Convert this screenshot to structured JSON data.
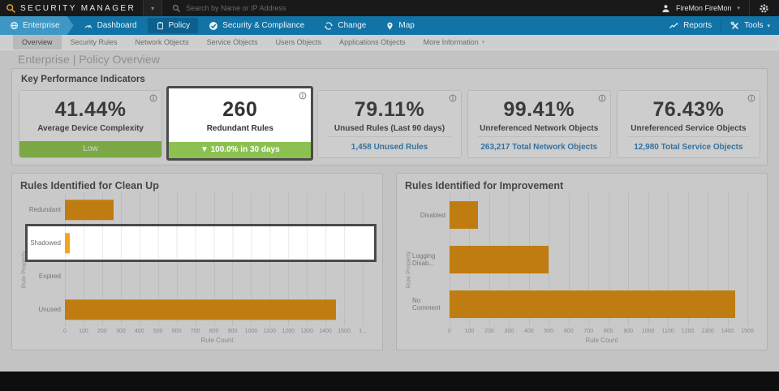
{
  "topbar": {
    "logo": "SECURITY MANAGER",
    "search_placeholder": "Search by Name or IP Address",
    "user": "FireMon FireMon"
  },
  "nav": {
    "items": [
      {
        "label": "Enterprise"
      },
      {
        "label": "Dashboard"
      },
      {
        "label": "Policy"
      },
      {
        "label": "Security & Compliance"
      },
      {
        "label": "Change"
      },
      {
        "label": "Map"
      }
    ],
    "right": [
      {
        "label": "Reports"
      },
      {
        "label": "Tools"
      }
    ]
  },
  "subnav": {
    "items": [
      {
        "label": "Overview",
        "active": true
      },
      {
        "label": "Security Rules"
      },
      {
        "label": "Network Objects"
      },
      {
        "label": "Service Objects"
      },
      {
        "label": "Users Objects"
      },
      {
        "label": "Applications Objects"
      },
      {
        "label": "More Information",
        "caret": true
      }
    ]
  },
  "breadcrumb": "Enterprise | Policy Overview",
  "kpi": {
    "heading": "Key Performance Indicators",
    "cards": [
      {
        "value": "41.44%",
        "label": "Average Device Complexity",
        "footer_type": "badge",
        "footer_text": "Low",
        "highlighted": false
      },
      {
        "value": "260",
        "label": "Redundant Rules",
        "footer_type": "badge",
        "footer_text": "▼ 100.0% in 30 days",
        "highlighted": true
      },
      {
        "value": "79.11%",
        "label": "Unused Rules (Last 90 days)",
        "footer_type": "link",
        "footer_text": "1,458 Unused Rules",
        "highlighted": false
      },
      {
        "value": "99.41%",
        "label": "Unreferenced Network Objects",
        "footer_type": "link",
        "footer_text": "263,217 Total Network Objects",
        "highlighted": false
      },
      {
        "value": "76.43%",
        "label": "Unreferenced Service Objects",
        "footer_type": "link",
        "footer_text": "12,980 Total Service Objects",
        "highlighted": false
      }
    ]
  },
  "chart_data": [
    {
      "type": "bar",
      "orientation": "horizontal",
      "title": "Rules Identified for Clean Up",
      "categories": [
        "Redundant",
        "Shadowed",
        "Expired",
        "Unused"
      ],
      "values": [
        260,
        25,
        0,
        1458
      ],
      "xlabel": "Rule Count",
      "ylabel": "Rule Property",
      "xlim": [
        0,
        1600
      ],
      "tick_step": 100,
      "tick_labels": [
        "0",
        "100",
        "200",
        "300",
        "400",
        "500",
        "600",
        "700",
        "800",
        "900",
        "1000",
        "1100",
        "1200",
        "1300",
        "1400",
        "1500",
        "1..."
      ],
      "grid": true,
      "highlighted_category": "Shadowed",
      "bar_color": "#bf7c10",
      "highlight_bar_color": "#f6a21c"
    },
    {
      "type": "bar",
      "orientation": "horizontal",
      "title": "Rules Identified for Improvement",
      "categories": [
        "Disabled",
        "Logging Disab...",
        "No Comment"
      ],
      "values": [
        145,
        500,
        1440
      ],
      "xlabel": "Rule Count",
      "ylabel": "Rule Property",
      "xlim": [
        0,
        1500
      ],
      "tick_step": 100,
      "tick_labels": [
        "0",
        "100",
        "200",
        "300",
        "400",
        "500",
        "600",
        "700",
        "800",
        "900",
        "1000",
        "1100",
        "1200",
        "1300",
        "1400",
        "1500"
      ],
      "grid": true,
      "highlighted_category": null,
      "bar_color": "#bf7c10"
    }
  ],
  "icons": {
    "logo": "magnifier-icon",
    "search": "search-icon",
    "user": "user-icon",
    "settings": "gear-icon",
    "enterprise": "globe-icon",
    "dashboard": "gauge-icon",
    "policy": "clipboard-icon",
    "security_compliance": "circle-check-icon",
    "change": "refresh-icon",
    "map": "map-pin-icon",
    "reports": "line-chart-icon",
    "tools": "wrench-icon",
    "info": "info-circle-icon",
    "caret": "caret-down-icon"
  },
  "colors": {
    "nav_blue": "#1173a6",
    "nav_blue_light": "#3e97c5",
    "nav_blue_dark": "#0c5f8e",
    "bar_orange_dim": "#bf7c10",
    "bar_orange_bright": "#f6a21c",
    "badge_green_dim": "#7ba844",
    "badge_green_bright": "#8cc152",
    "link_blue": "#35719f",
    "highlight_border": "#4a4a4a"
  }
}
